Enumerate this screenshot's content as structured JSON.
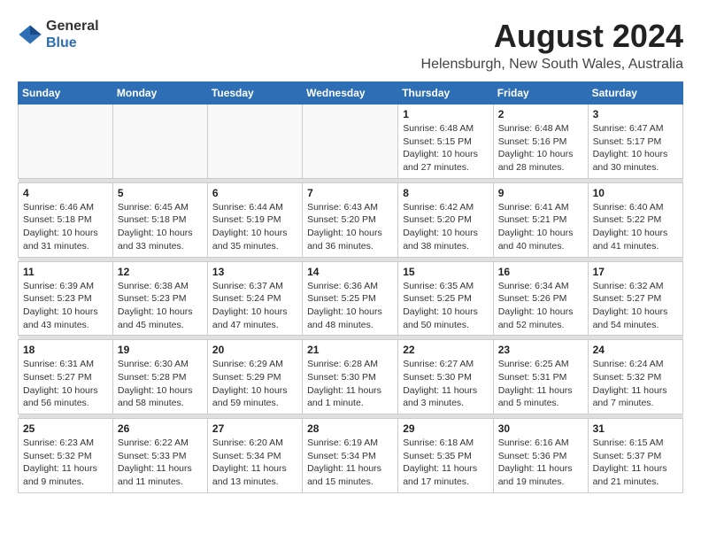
{
  "logo": {
    "general": "General",
    "blue": "Blue"
  },
  "title": "August 2024",
  "subtitle": "Helensburgh, New South Wales, Australia",
  "days_header": [
    "Sunday",
    "Monday",
    "Tuesday",
    "Wednesday",
    "Thursday",
    "Friday",
    "Saturday"
  ],
  "weeks": [
    [
      {
        "day": "",
        "info": ""
      },
      {
        "day": "",
        "info": ""
      },
      {
        "day": "",
        "info": ""
      },
      {
        "day": "",
        "info": ""
      },
      {
        "day": "1",
        "info": "Sunrise: 6:48 AM\nSunset: 5:15 PM\nDaylight: 10 hours\nand 27 minutes."
      },
      {
        "day": "2",
        "info": "Sunrise: 6:48 AM\nSunset: 5:16 PM\nDaylight: 10 hours\nand 28 minutes."
      },
      {
        "day": "3",
        "info": "Sunrise: 6:47 AM\nSunset: 5:17 PM\nDaylight: 10 hours\nand 30 minutes."
      }
    ],
    [
      {
        "day": "4",
        "info": "Sunrise: 6:46 AM\nSunset: 5:18 PM\nDaylight: 10 hours\nand 31 minutes."
      },
      {
        "day": "5",
        "info": "Sunrise: 6:45 AM\nSunset: 5:18 PM\nDaylight: 10 hours\nand 33 minutes."
      },
      {
        "day": "6",
        "info": "Sunrise: 6:44 AM\nSunset: 5:19 PM\nDaylight: 10 hours\nand 35 minutes."
      },
      {
        "day": "7",
        "info": "Sunrise: 6:43 AM\nSunset: 5:20 PM\nDaylight: 10 hours\nand 36 minutes."
      },
      {
        "day": "8",
        "info": "Sunrise: 6:42 AM\nSunset: 5:20 PM\nDaylight: 10 hours\nand 38 minutes."
      },
      {
        "day": "9",
        "info": "Sunrise: 6:41 AM\nSunset: 5:21 PM\nDaylight: 10 hours\nand 40 minutes."
      },
      {
        "day": "10",
        "info": "Sunrise: 6:40 AM\nSunset: 5:22 PM\nDaylight: 10 hours\nand 41 minutes."
      }
    ],
    [
      {
        "day": "11",
        "info": "Sunrise: 6:39 AM\nSunset: 5:23 PM\nDaylight: 10 hours\nand 43 minutes."
      },
      {
        "day": "12",
        "info": "Sunrise: 6:38 AM\nSunset: 5:23 PM\nDaylight: 10 hours\nand 45 minutes."
      },
      {
        "day": "13",
        "info": "Sunrise: 6:37 AM\nSunset: 5:24 PM\nDaylight: 10 hours\nand 47 minutes."
      },
      {
        "day": "14",
        "info": "Sunrise: 6:36 AM\nSunset: 5:25 PM\nDaylight: 10 hours\nand 48 minutes."
      },
      {
        "day": "15",
        "info": "Sunrise: 6:35 AM\nSunset: 5:25 PM\nDaylight: 10 hours\nand 50 minutes."
      },
      {
        "day": "16",
        "info": "Sunrise: 6:34 AM\nSunset: 5:26 PM\nDaylight: 10 hours\nand 52 minutes."
      },
      {
        "day": "17",
        "info": "Sunrise: 6:32 AM\nSunset: 5:27 PM\nDaylight: 10 hours\nand 54 minutes."
      }
    ],
    [
      {
        "day": "18",
        "info": "Sunrise: 6:31 AM\nSunset: 5:27 PM\nDaylight: 10 hours\nand 56 minutes."
      },
      {
        "day": "19",
        "info": "Sunrise: 6:30 AM\nSunset: 5:28 PM\nDaylight: 10 hours\nand 58 minutes."
      },
      {
        "day": "20",
        "info": "Sunrise: 6:29 AM\nSunset: 5:29 PM\nDaylight: 10 hours\nand 59 minutes."
      },
      {
        "day": "21",
        "info": "Sunrise: 6:28 AM\nSunset: 5:30 PM\nDaylight: 11 hours\nand 1 minute."
      },
      {
        "day": "22",
        "info": "Sunrise: 6:27 AM\nSunset: 5:30 PM\nDaylight: 11 hours\nand 3 minutes."
      },
      {
        "day": "23",
        "info": "Sunrise: 6:25 AM\nSunset: 5:31 PM\nDaylight: 11 hours\nand 5 minutes."
      },
      {
        "day": "24",
        "info": "Sunrise: 6:24 AM\nSunset: 5:32 PM\nDaylight: 11 hours\nand 7 minutes."
      }
    ],
    [
      {
        "day": "25",
        "info": "Sunrise: 6:23 AM\nSunset: 5:32 PM\nDaylight: 11 hours\nand 9 minutes."
      },
      {
        "day": "26",
        "info": "Sunrise: 6:22 AM\nSunset: 5:33 PM\nDaylight: 11 hours\nand 11 minutes."
      },
      {
        "day": "27",
        "info": "Sunrise: 6:20 AM\nSunset: 5:34 PM\nDaylight: 11 hours\nand 13 minutes."
      },
      {
        "day": "28",
        "info": "Sunrise: 6:19 AM\nSunset: 5:34 PM\nDaylight: 11 hours\nand 15 minutes."
      },
      {
        "day": "29",
        "info": "Sunrise: 6:18 AM\nSunset: 5:35 PM\nDaylight: 11 hours\nand 17 minutes."
      },
      {
        "day": "30",
        "info": "Sunrise: 6:16 AM\nSunset: 5:36 PM\nDaylight: 11 hours\nand 19 minutes."
      },
      {
        "day": "31",
        "info": "Sunrise: 6:15 AM\nSunset: 5:37 PM\nDaylight: 11 hours\nand 21 minutes."
      }
    ]
  ]
}
